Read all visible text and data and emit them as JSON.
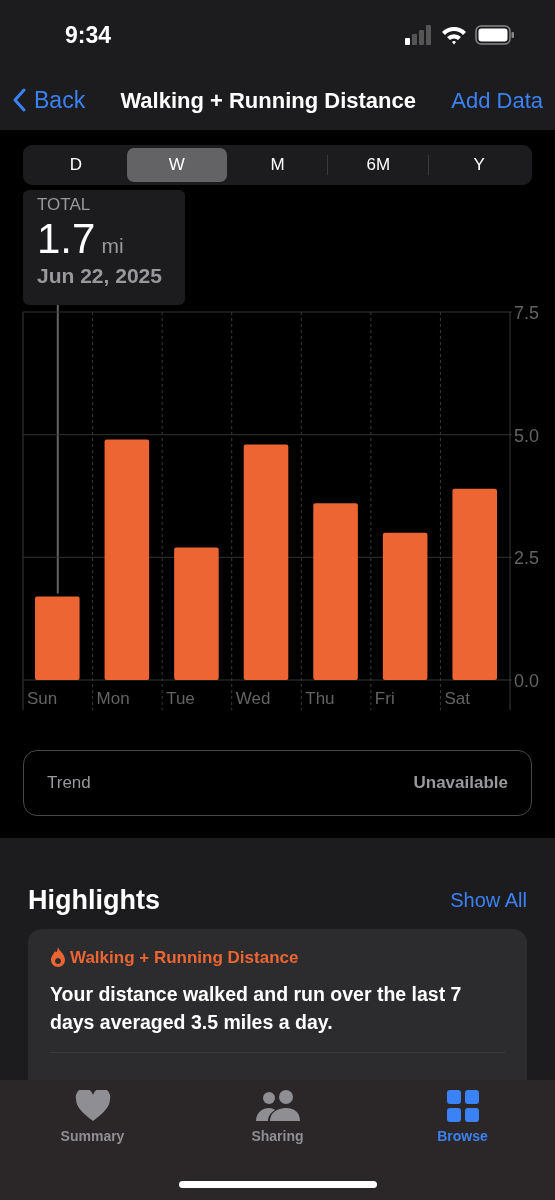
{
  "status_bar": {
    "time": "9:34"
  },
  "nav": {
    "back": "Back",
    "title": "Walking + Running Distance",
    "action": "Add Data"
  },
  "segments": [
    {
      "label": "D",
      "selected": false
    },
    {
      "label": "W",
      "selected": true
    },
    {
      "label": "M",
      "selected": false
    },
    {
      "label": "6M",
      "selected": false
    },
    {
      "label": "Y",
      "selected": false
    }
  ],
  "tooltip": {
    "label": "TOTAL",
    "value": "1.7",
    "unit": "mi",
    "date": "Jun 22, 2025"
  },
  "chart_data": {
    "type": "bar",
    "categories": [
      "Sun",
      "Mon",
      "Tue",
      "Wed",
      "Thu",
      "Fri",
      "Sat"
    ],
    "values": [
      1.7,
      4.9,
      2.7,
      4.8,
      3.6,
      3.0,
      3.9
    ],
    "ylim": [
      0,
      7.5
    ],
    "yticks": [
      {
        "value": 0,
        "label": "0.0"
      },
      {
        "value": 2.5,
        "label": "2.5"
      },
      {
        "value": 5,
        "label": "5.0"
      },
      {
        "value": 7.5,
        "label": "7.5"
      }
    ]
  },
  "trend": {
    "label": "Trend",
    "value": "Unavailable"
  },
  "highlights": {
    "title": "Highlights",
    "action": "Show All",
    "card": {
      "title": "Walking + Running Distance",
      "text": "Your distance walked and run over the last 7 days averaged 3.5 miles a day."
    }
  },
  "tab_bar": [
    {
      "label": "Summary",
      "selected": false
    },
    {
      "label": "Sharing",
      "selected": false
    },
    {
      "label": "Browse",
      "selected": true
    }
  ]
}
